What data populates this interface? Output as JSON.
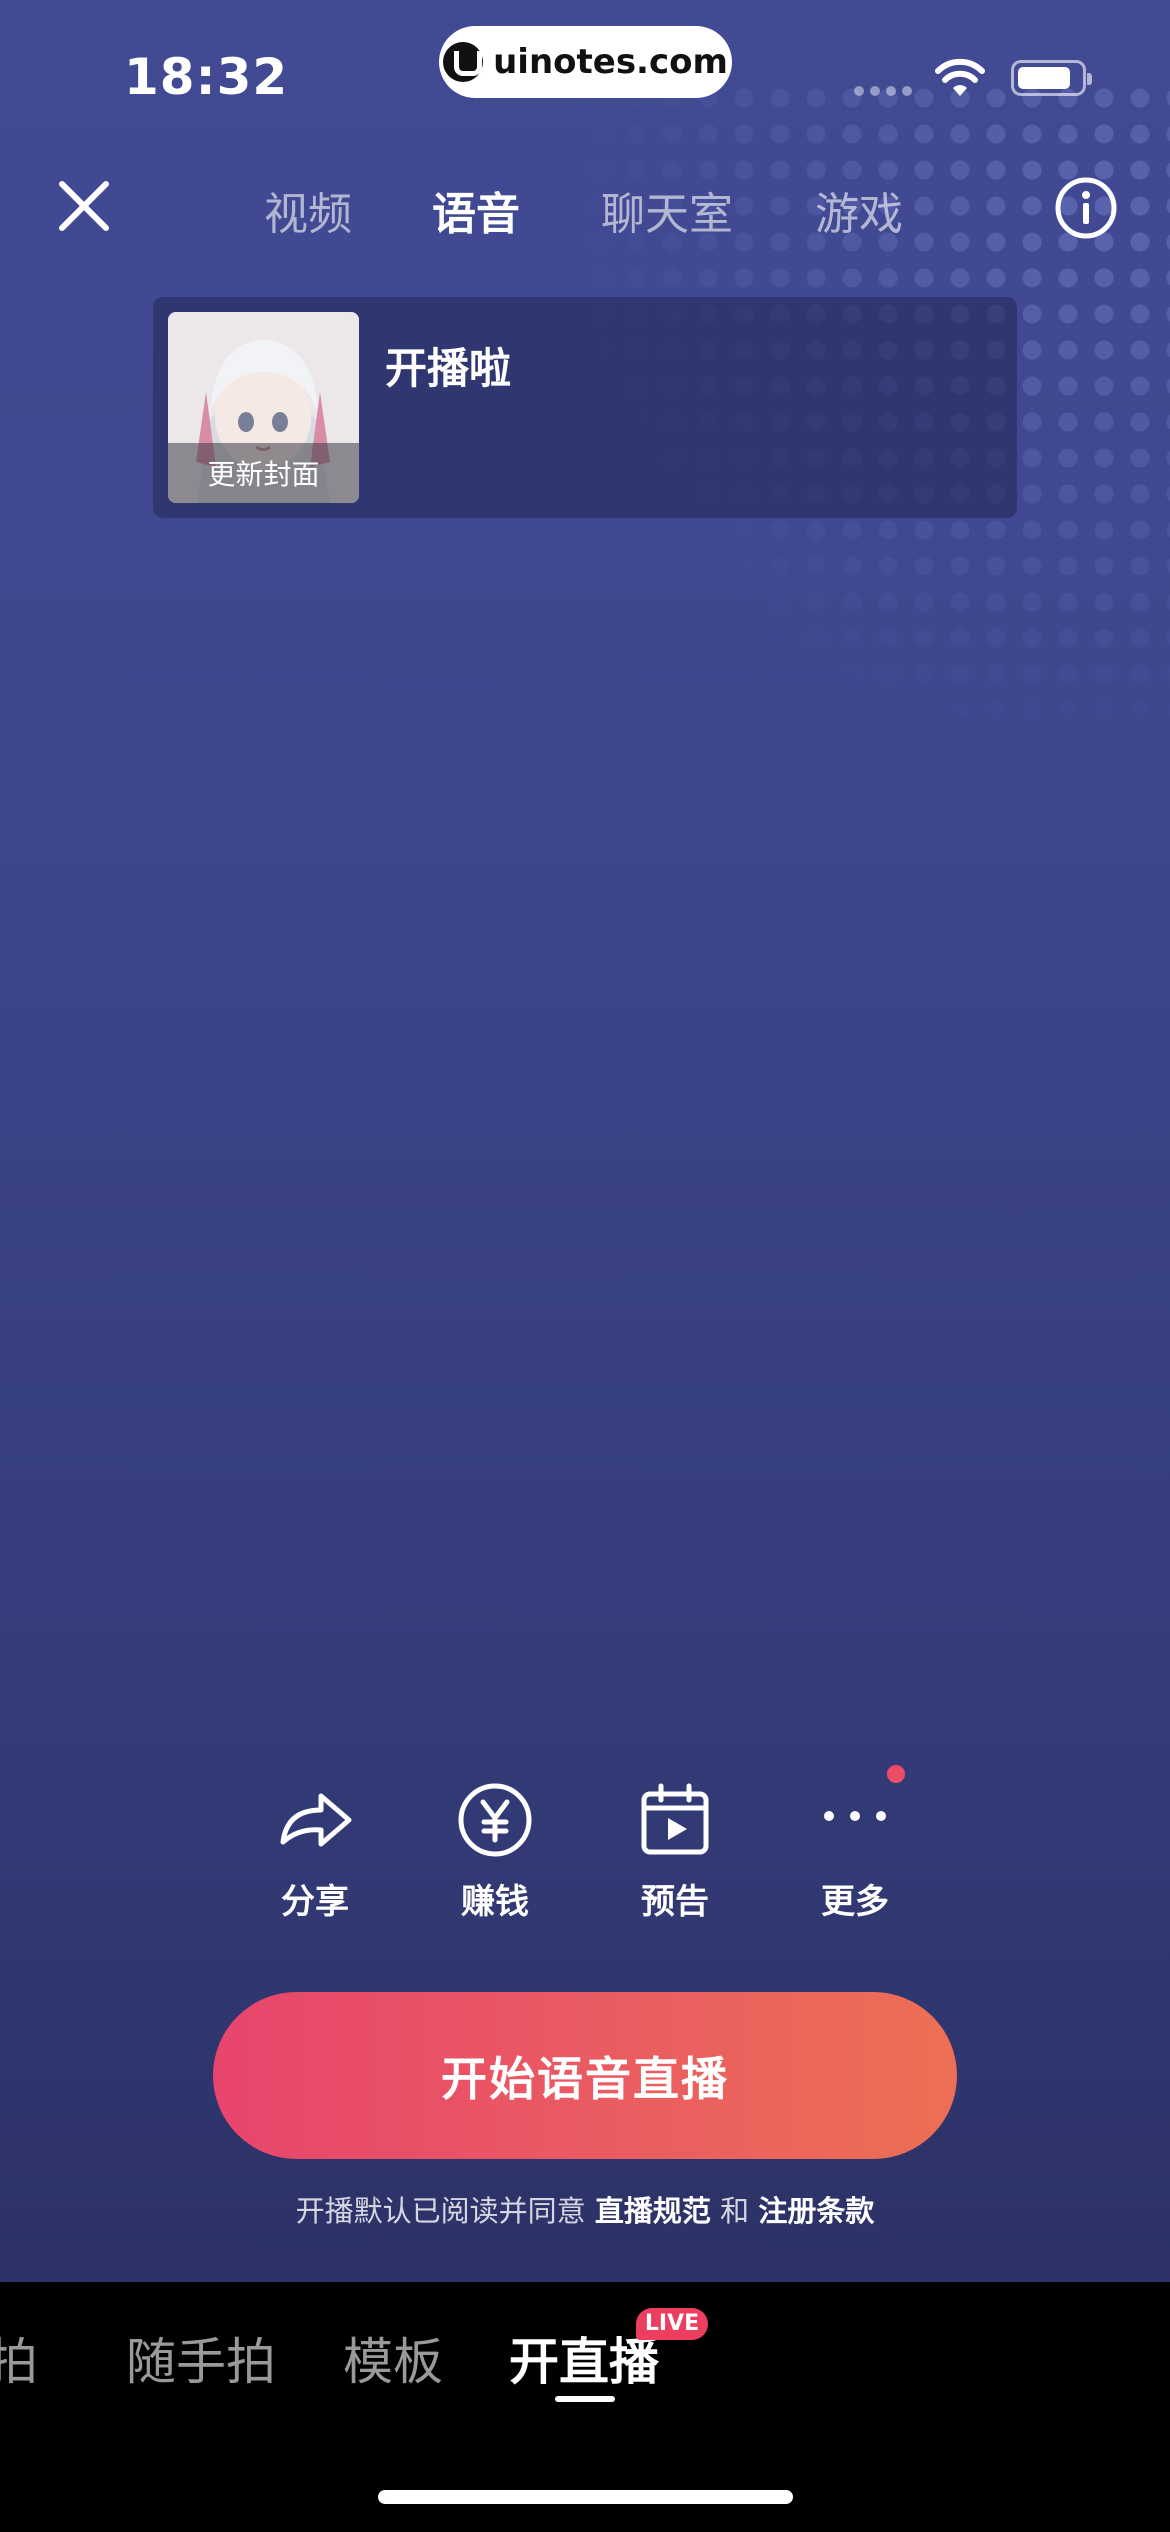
{
  "status_bar": {
    "time": "18:32",
    "url": "uinotes.com"
  },
  "top_tabs": [
    {
      "label": "视频",
      "active": false
    },
    {
      "label": "语音",
      "active": true
    },
    {
      "label": "聊天室",
      "active": false
    },
    {
      "label": "游戏",
      "active": false
    }
  ],
  "cover": {
    "update_label": "更新封面",
    "title": "开播啦"
  },
  "actions": [
    {
      "label": "分享",
      "icon": "share-icon"
    },
    {
      "label": "赚钱",
      "icon": "yen-coin-icon"
    },
    {
      "label": "预告",
      "icon": "calendar-play-icon"
    },
    {
      "label": "更多",
      "icon": "more-dots-icon",
      "has_dot": true
    }
  ],
  "start_button": "开始语音直播",
  "agreement": {
    "prefix": "开播默认已阅读并同意",
    "link1": "直播规范",
    "and": "和",
    "link2": "注册条款"
  },
  "bottom_tabs": [
    {
      "label": "拍",
      "active": false
    },
    {
      "label": "随手拍",
      "active": false
    },
    {
      "label": "模板",
      "active": false
    },
    {
      "label": "开直播",
      "active": true
    }
  ],
  "live_badge": "LIVE",
  "colors": {
    "accent_start": "#e8456d",
    "accent_end": "#ed6f55",
    "background_top": "#414a93",
    "background_bottom": "#2c3266"
  }
}
